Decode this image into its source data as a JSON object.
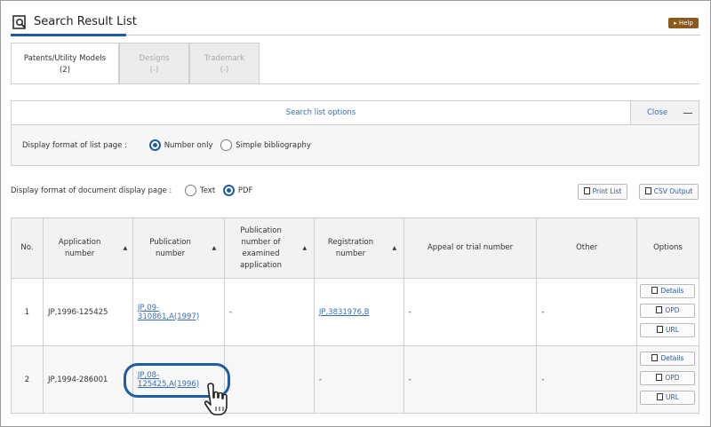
{
  "header": {
    "title": "Search Result List",
    "help_label": "▸ Help"
  },
  "tabs": [
    {
      "name": "Patents/Utility Models",
      "count": "(2)"
    },
    {
      "name": "Designs",
      "count": "(-)"
    },
    {
      "name": "Trademark",
      "count": "(-)"
    }
  ],
  "search_options": {
    "title": "Search list options",
    "close_label": "Close",
    "list_format_label": "Display format of list page :",
    "list_format_options": [
      "Number only",
      "Simple bibliography"
    ],
    "list_format_selected": "Number only"
  },
  "document_display": {
    "label": "Display format of document display page :",
    "options": [
      "Text",
      "PDF"
    ],
    "selected": "PDF"
  },
  "toolbar": {
    "print_label": "Print List",
    "csv_label": "CSV Output"
  },
  "table": {
    "headers": {
      "no": "No.",
      "application": "Application number",
      "publication": "Publication number",
      "examined": "Publication number of examined application",
      "registration": "Registration number",
      "appeal": "Appeal or trial number",
      "other": "Other",
      "options": "Options"
    },
    "rows": [
      {
        "no": "1",
        "application": "JP,1996-125425",
        "publication": "JP,09-310861,A(1997)",
        "examined": "-",
        "registration": "JP,3831976,B",
        "appeal": "-",
        "other": "-"
      },
      {
        "no": "2",
        "application": "JP,1994-286001",
        "publication": "JP,08-125425,A(1996)",
        "examined": "",
        "registration": "-",
        "appeal": "-",
        "other": "-"
      }
    ],
    "option_buttons": {
      "details": "Details",
      "opd": "OPD",
      "url": "URL"
    }
  }
}
